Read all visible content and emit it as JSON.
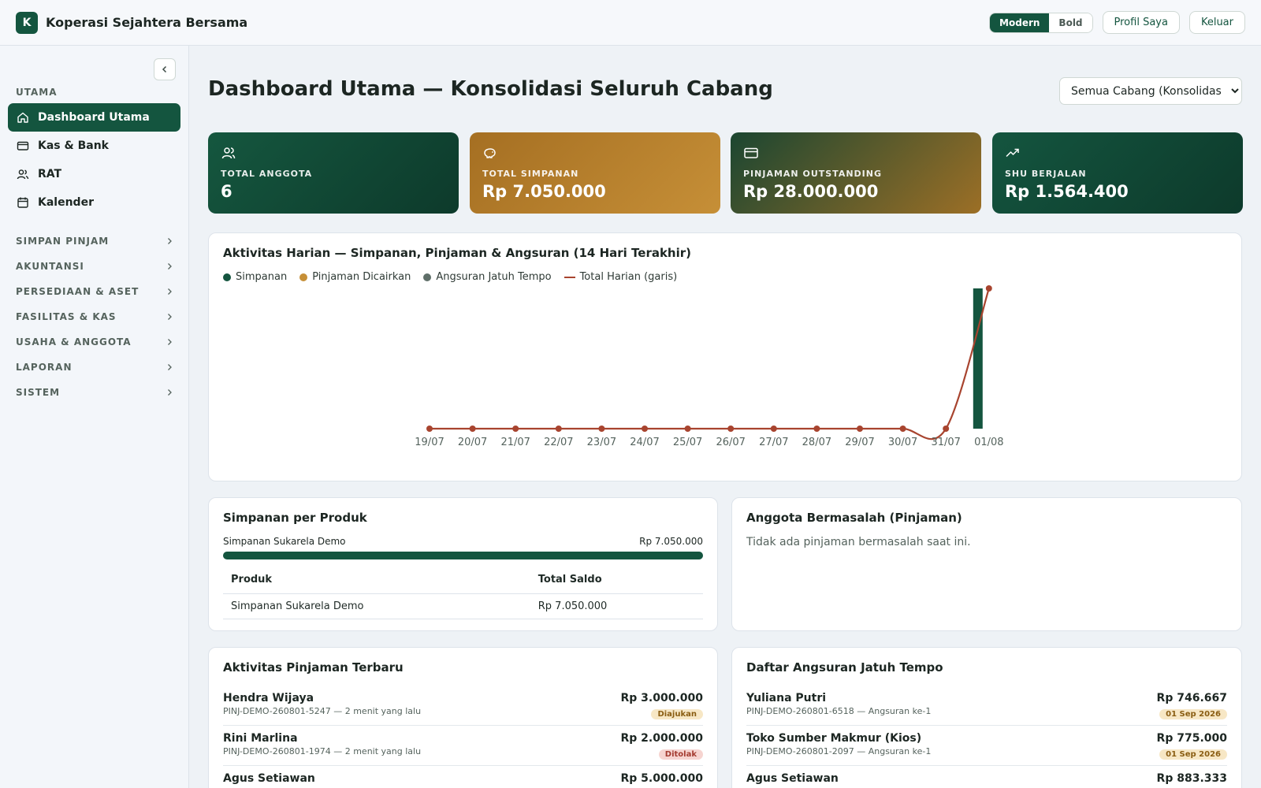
{
  "app": {
    "logo_letter": "K",
    "title": "Koperasi Sejahtera Bersama"
  },
  "topbar": {
    "mode_modern": "Modern",
    "mode_bold": "Bold",
    "profile_label": "Profil Saya",
    "logout_label": "Keluar"
  },
  "sidebar": {
    "section_label": "UTAMA",
    "items": [
      {
        "label": "Dashboard Utama",
        "icon": "home-icon"
      },
      {
        "label": "Kas & Bank",
        "icon": "card-icon"
      },
      {
        "label": "RAT",
        "icon": "users-icon"
      },
      {
        "label": "Kalender",
        "icon": "calendar-icon"
      }
    ],
    "groups": [
      "SIMPAN PINJAM",
      "AKUNTANSI",
      "PERSEDIAAN & ASET",
      "FASILITAS & KAS",
      "USAHA & ANGGOTA",
      "LAPORAN",
      "SISTEM"
    ]
  },
  "main": {
    "title": "Dashboard Utama — Konsolidasi Seluruh Cabang",
    "branch_selected": "Semua Cabang (Konsolidasi)"
  },
  "stats": [
    {
      "label": "TOTAL ANGGOTA",
      "value": "6",
      "icon": "users-icon"
    },
    {
      "label": "TOTAL SIMPANAN",
      "value": "Rp 7.050.000",
      "icon": "piggy-bank-icon"
    },
    {
      "label": "PINJAMAN OUTSTANDING",
      "value": "Rp 28.000.000",
      "icon": "credit-card-icon"
    },
    {
      "label": "SHU BERJALAN",
      "value": "Rp 1.564.400",
      "icon": "trending-up-icon"
    }
  ],
  "activity": {
    "title": "Aktivitas Harian — Simpanan, Pinjaman & Angsuran (14 Hari Terakhir)",
    "legend": [
      {
        "label": "Simpanan",
        "color": "#14553f"
      },
      {
        "label": "Pinjaman Dicairkan",
        "color": "#c68f37"
      },
      {
        "label": "Angsuran Jatuh Tempo",
        "color": "#5f6f69"
      },
      {
        "label": "Total Harian (garis)",
        "color": "#a8442f"
      }
    ]
  },
  "chart_data": {
    "type": "bar",
    "categories": [
      "19/07",
      "20/07",
      "21/07",
      "22/07",
      "23/07",
      "24/07",
      "25/07",
      "26/07",
      "27/07",
      "28/07",
      "29/07",
      "30/07",
      "31/07",
      "01/08"
    ],
    "series": [
      {
        "name": "Simpanan",
        "values": [
          0,
          0,
          0,
          0,
          0,
          0,
          0,
          0,
          0,
          0,
          0,
          0,
          0,
          1
        ]
      },
      {
        "name": "Pinjaman Dicairkan",
        "values": [
          0,
          0,
          0,
          0,
          0,
          0,
          0,
          0,
          0,
          0,
          0,
          0,
          0,
          0
        ]
      },
      {
        "name": "Angsuran Jatuh Tempo",
        "values": [
          0,
          0,
          0,
          0,
          0,
          0,
          0,
          0,
          0,
          0,
          0,
          0,
          0,
          0
        ]
      },
      {
        "name": "Total Harian (garis)",
        "values": [
          0,
          0,
          0,
          0,
          0,
          0,
          0,
          0,
          0,
          0,
          0,
          0,
          0,
          1
        ]
      }
    ],
    "ylim": [
      0,
      1
    ],
    "legend_position": "top-left",
    "grid": false
  },
  "products": {
    "title": "Simpanan per Produk",
    "bar_name": "Simpanan Sukarela Demo",
    "bar_value": "Rp 7.050.000",
    "bar_fraction": 1.0,
    "headers": [
      "Produk",
      "Total Saldo"
    ],
    "rows": [
      [
        "Simpanan Sukarela Demo",
        "Rp 7.050.000"
      ]
    ]
  },
  "problems": {
    "title": "Anggota Bermasalah (Pinjaman)",
    "empty_text": "Tidak ada pinjaman bermasalah saat ini."
  },
  "loans": {
    "title": "Aktivitas Pinjaman Terbaru",
    "items": [
      {
        "name": "Hendra Wijaya",
        "sub": "PINJ-DEMO-260801-5247 — 2 menit yang lalu",
        "amount": "Rp 3.000.000",
        "status": "Diajukan",
        "status_color": "yellow"
      },
      {
        "name": "Rini Marlina",
        "sub": "PINJ-DEMO-260801-1974 — 2 menit yang lalu",
        "amount": "Rp 2.000.000",
        "status": "Ditolak",
        "status_color": "red"
      },
      {
        "name": "Agus Setiawan",
        "sub": "",
        "amount": "Rp 5.000.000",
        "status": "",
        "status_color": ""
      }
    ]
  },
  "due": {
    "title": "Daftar Angsuran Jatuh Tempo",
    "items": [
      {
        "name": "Yuliana Putri",
        "sub": "PINJ-DEMO-260801-6518 — Angsuran ke-1",
        "amount": "Rp 746.667",
        "date": "01 Sep 2026"
      },
      {
        "name": "Toko Sumber Makmur (Kios)",
        "sub": "PINJ-DEMO-260801-2097 — Angsuran ke-1",
        "amount": "Rp 775.000",
        "date": "01 Sep 2026"
      },
      {
        "name": "Agus Setiawan",
        "sub": "",
        "amount": "Rp 883.333",
        "date": ""
      }
    ]
  }
}
